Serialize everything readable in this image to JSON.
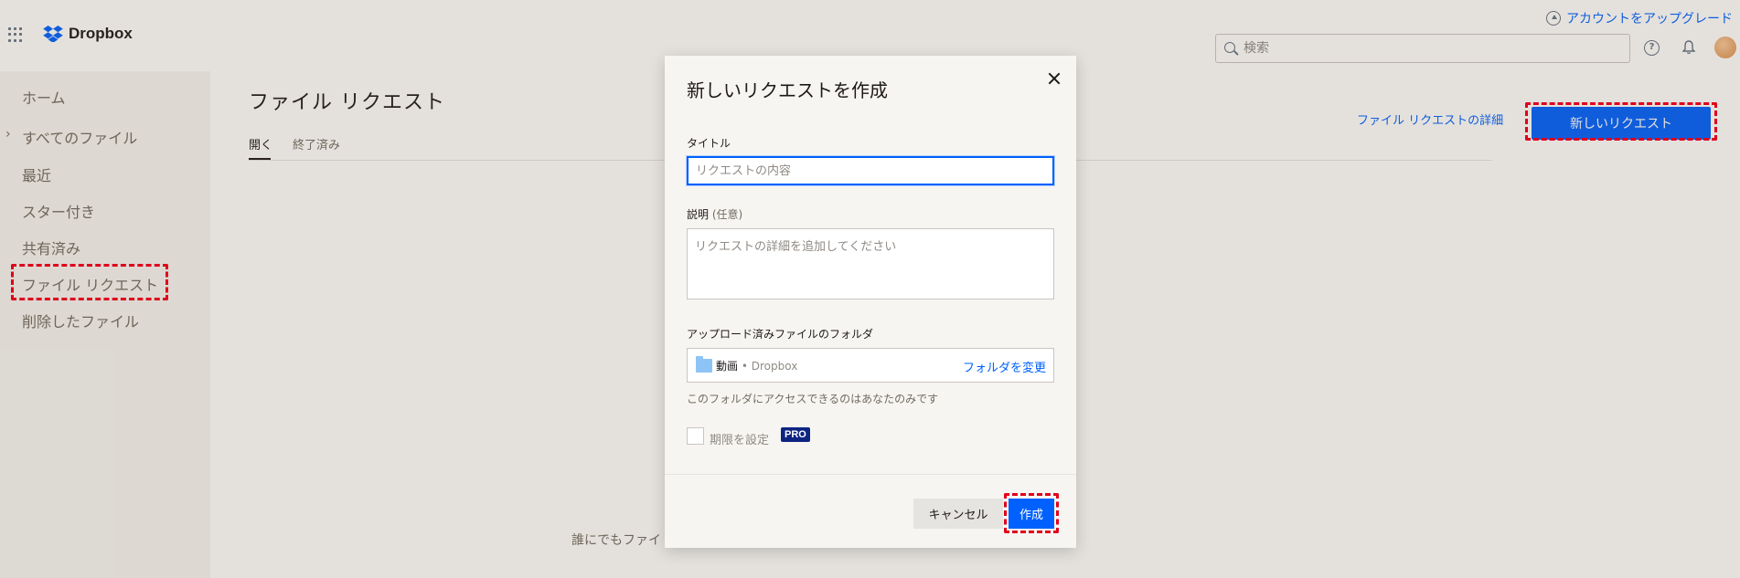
{
  "brand": {
    "name": "Dropbox"
  },
  "header": {
    "upgrade_label": "アカウントをアップグレード",
    "search_placeholder": "検索"
  },
  "sidebar": {
    "items": [
      {
        "label": "ホーム"
      },
      {
        "label": "すべてのファイル"
      },
      {
        "label": "最近"
      },
      {
        "label": "スター付き"
      },
      {
        "label": "共有済み"
      },
      {
        "label": "ファイル リクエスト"
      },
      {
        "label": "削除したファイル"
      }
    ]
  },
  "main": {
    "title": "ファイル リクエスト",
    "tabs": [
      {
        "label": "開く"
      },
      {
        "label": "終了済み"
      }
    ],
    "detail_link": "ファイル リクエストの詳細",
    "new_request_button": "新しいリクエスト",
    "empty_text": "誰にでもファイ"
  },
  "modal": {
    "title": "新しいリクエストを作成",
    "title_label": "タイトル",
    "title_placeholder": "リクエストの内容",
    "description_label": "説明",
    "description_optional": "(任意)",
    "description_placeholder": "リクエストの詳細を追加してください",
    "folder_label": "アップロード済みファイルのフォルダ",
    "folder_name": "動画",
    "folder_separator": " • ",
    "folder_root": "Dropbox",
    "change_folder": "フォルダを変更",
    "folder_note": "このフォルダにアクセスできるのはあなたのみです",
    "deadline_label": "期限を設定",
    "pro_badge": "PRO",
    "cancel_button": "キャンセル",
    "create_button": "作成"
  },
  "colors": {
    "accent": "#0061fe",
    "highlight": "#e0001b",
    "pro_badge": "#0d2481"
  }
}
